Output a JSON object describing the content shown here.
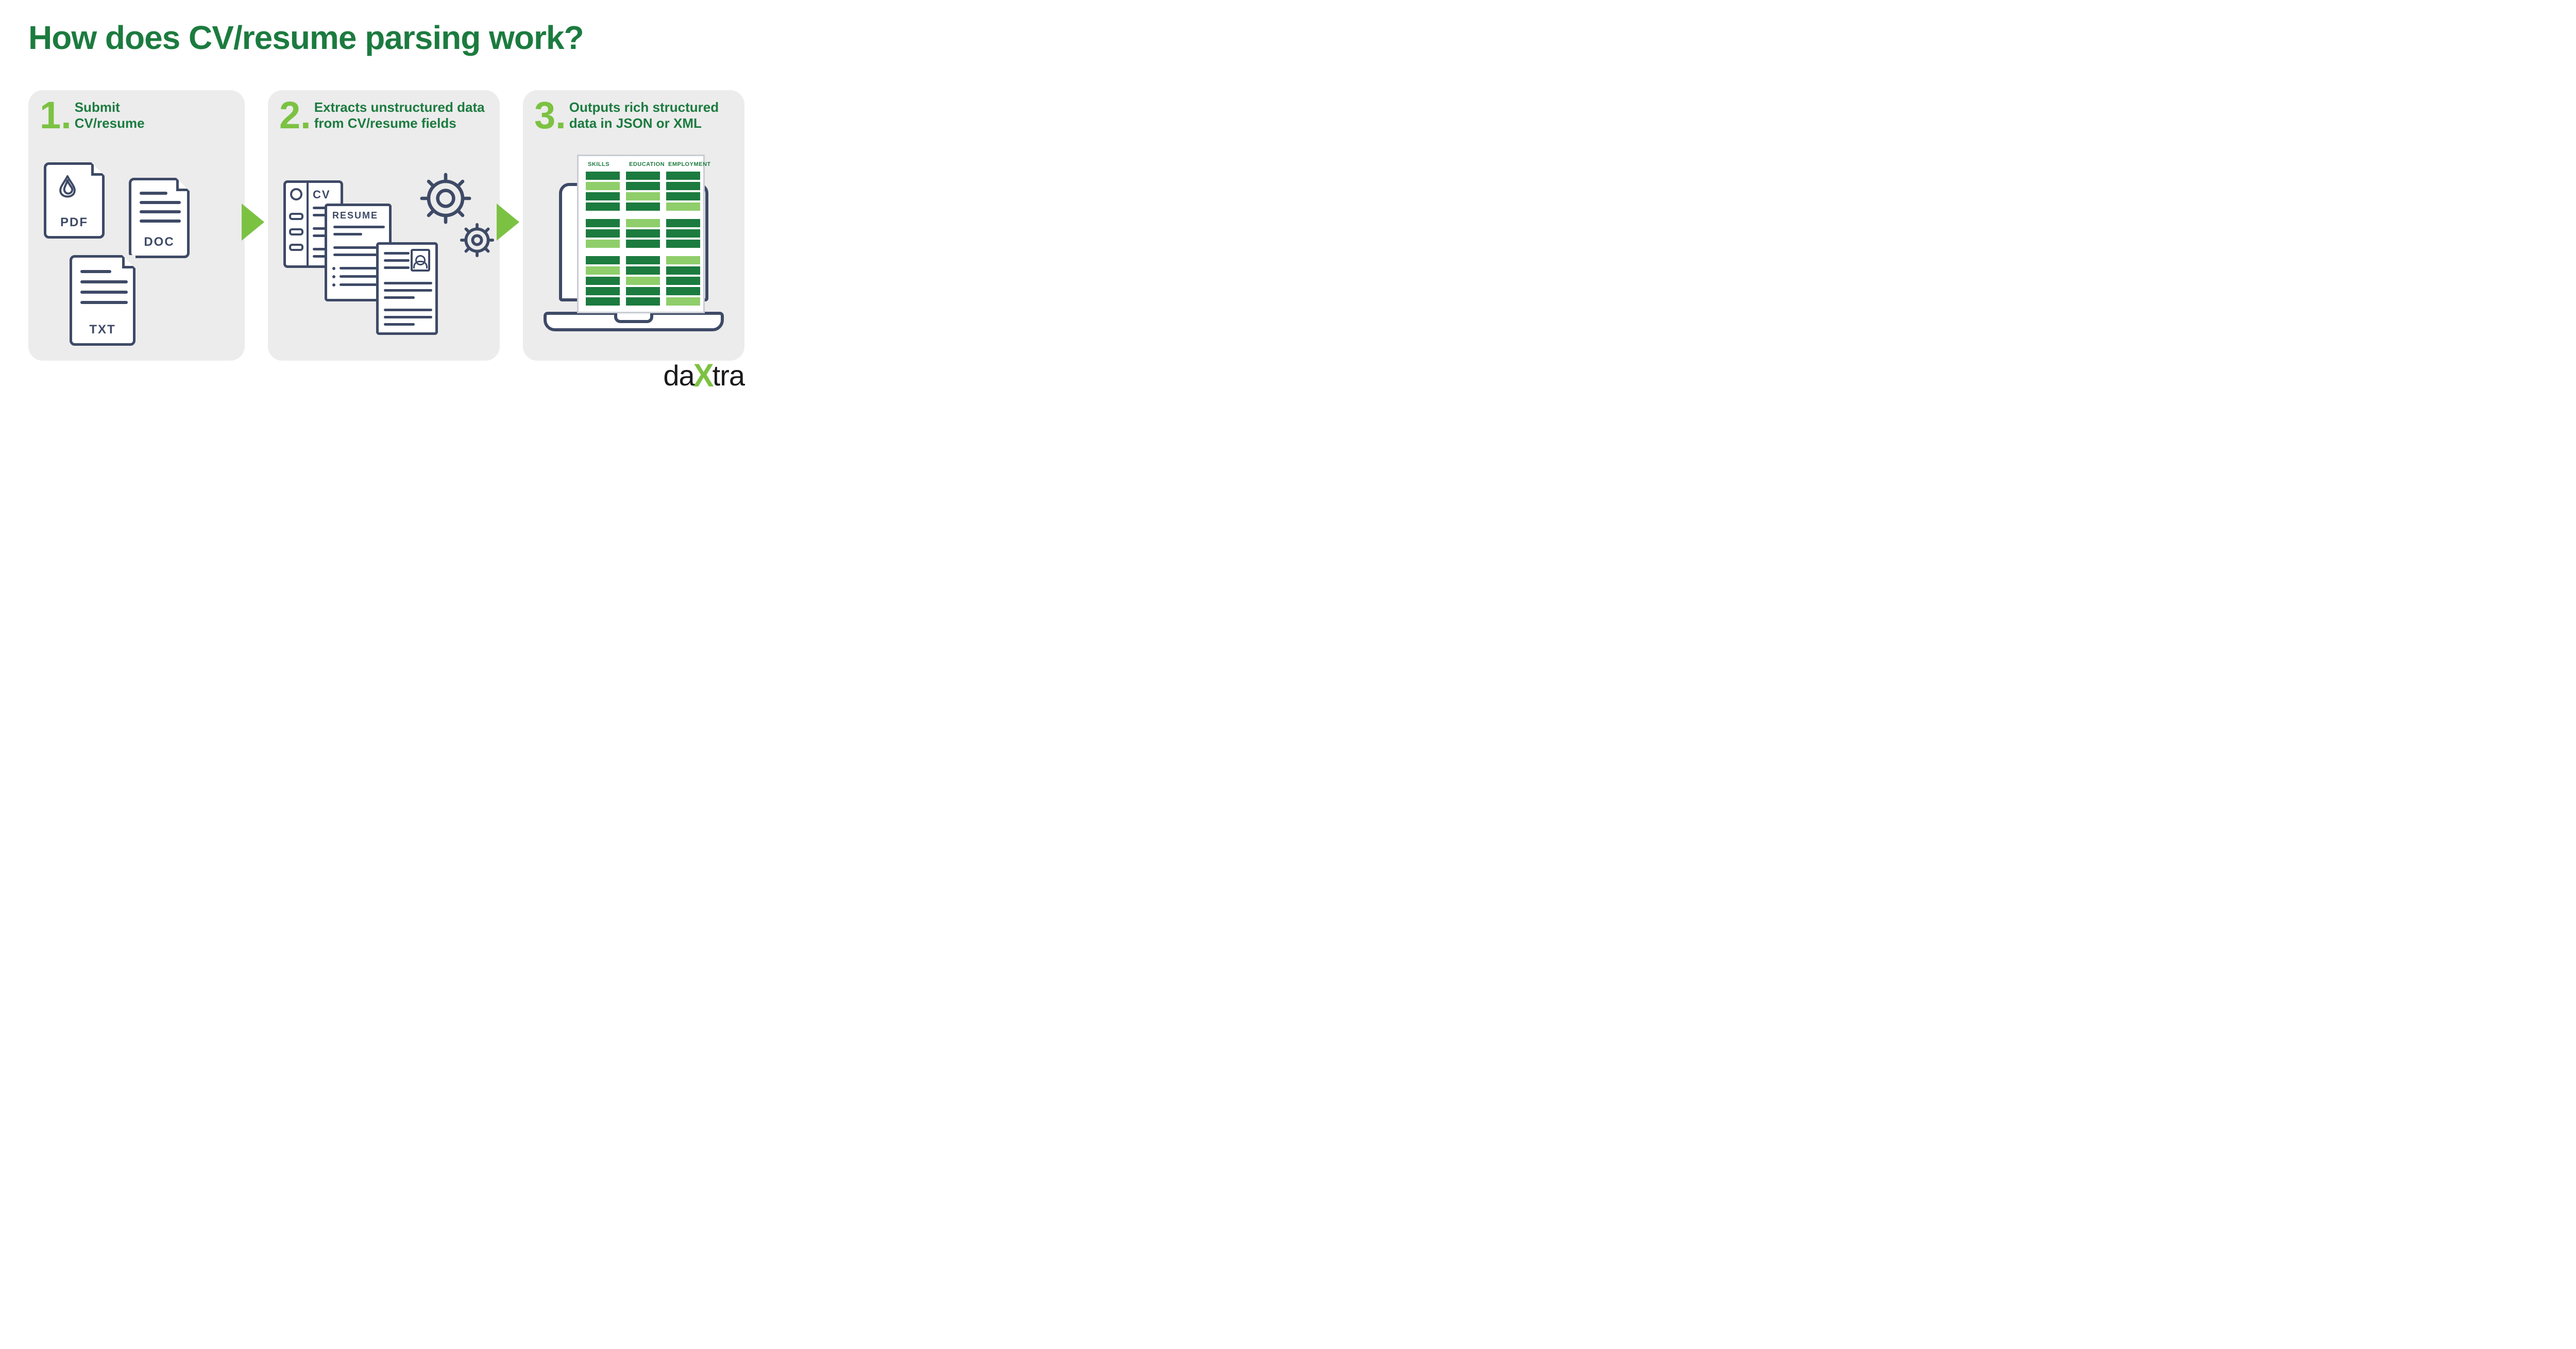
{
  "title": "How does CV/resume parsing work?",
  "steps": [
    {
      "num": "1",
      "text": "Submit\nCV/resume"
    },
    {
      "num": "2",
      "text": "Extracts unstructured data from CV/resume fields"
    },
    {
      "num": "3",
      "text": "Outputs rich structured data in JSON or XML"
    }
  ],
  "fileLabels": {
    "pdf": "PDF",
    "doc": "DOC",
    "txt": "TXT"
  },
  "docLabels": {
    "cv": "CV",
    "resume": "RESUME"
  },
  "sheetHeaders": [
    "SKILLS",
    "EDUCATION",
    "EMPLOYMENT"
  ],
  "logo": {
    "pre": "da",
    "mid": "X",
    "post": "tra"
  },
  "colors": {
    "darkGreen": "#1c7b3f",
    "lightGreen": "#7cc242",
    "stroke": "#3e4a66",
    "panel": "#ececec"
  }
}
